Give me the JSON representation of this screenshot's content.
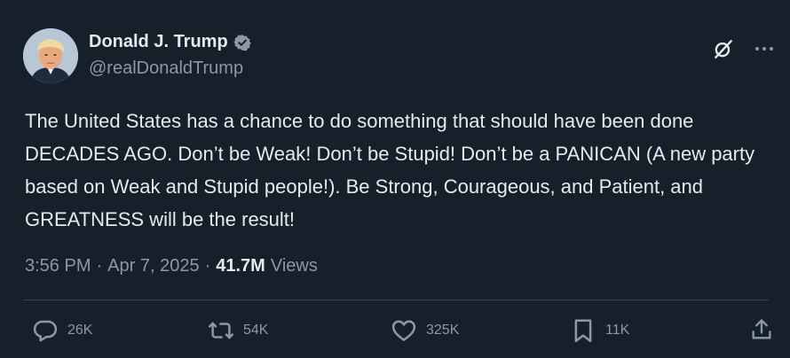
{
  "author": {
    "display_name": "Donald J. Trump",
    "handle": "@realDonaldTrump",
    "verified": true
  },
  "icons": {
    "verified": "verified-badge-icon",
    "grok": "grok-icon",
    "more": "more-dots-icon",
    "reply": "reply-icon",
    "retweet": "retweet-icon",
    "like": "heart-icon",
    "bookmark": "bookmark-icon",
    "share": "share-icon"
  },
  "tweet": {
    "text": "The United States has a chance to do something that should have been done DECADES AGO. Don’t be Weak! Don’t be Stupid! Don’t be a PANICAN (A new party based on Weak and Stupid people!). Be Strong, Courageous, and Patient, and GREATNESS will be the result!",
    "time": "3:56 PM",
    "separator": "·",
    "date": "Apr 7, 2025",
    "views_count": "41.7M",
    "views_label": "Views"
  },
  "actions": {
    "replies": "26K",
    "retweets": "54K",
    "likes": "325K",
    "bookmarks": "11K"
  },
  "colors": {
    "background": "#15202b",
    "text": "#e7e9ea",
    "secondary": "#8b98a5",
    "verified": "#8b98a5"
  }
}
